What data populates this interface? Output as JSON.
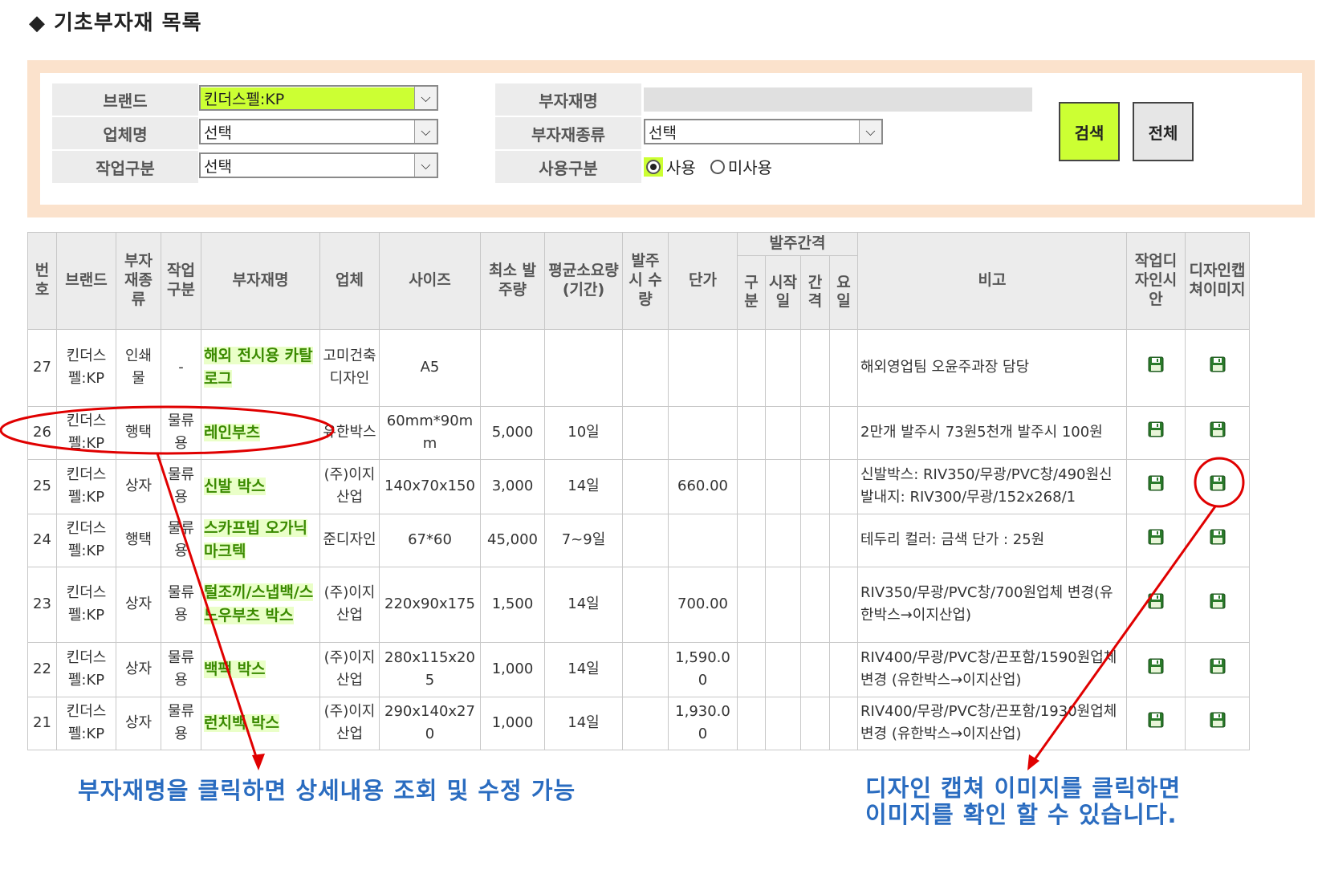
{
  "page": {
    "title": "기초부자재 목록",
    "title_icon": "diamond-icon"
  },
  "search": {
    "brand_label": "브랜드",
    "brand_value": "킨더스펠:KP",
    "vendor_label": "업체명",
    "vendor_value": "선택",
    "work_type_label": "작업구분",
    "work_type_value": "선택",
    "material_name_label": "부자재명",
    "material_name_value": "",
    "material_type_label": "부자재종류",
    "material_type_value": "선택",
    "usage_label": "사용구분",
    "usage_options": [
      "사용",
      "미사용"
    ],
    "usage_selected": "사용",
    "search_button": "검색",
    "all_button": "전체"
  },
  "table": {
    "headers": {
      "no": "번호",
      "brand": "브랜드",
      "material_type": "부자재종류",
      "work_type": "작업구분",
      "material_name": "부자재명",
      "vendor": "업체",
      "size": "사이즈",
      "min_order": "최소 발주량",
      "avg_lead": "평균소요량(기간)",
      "order_start_qty": "발주시 수량",
      "unit_price": "단가",
      "order_interval": "발주간격",
      "interval_type": "구분",
      "interval_start": "시작일",
      "interval_gap": "간격",
      "interval_day": "요일",
      "note": "비고",
      "work_design": "작업디자인시안",
      "design_capture": "디자인캡쳐이미지"
    },
    "rows": [
      {
        "no": "27",
        "brand": "킨더스펠:KP",
        "type": "인쇄물",
        "work": "-",
        "name": "해외 전시용 카탈로그",
        "vendor": "고미건축디자인",
        "size": "A5",
        "min": "",
        "avg": "",
        "qty": "",
        "price": "",
        "note": "해외영업팀 오윤주과장 담당"
      },
      {
        "no": "26",
        "brand": "킨더스펠:KP",
        "type": "행택",
        "work": "물류용",
        "name": "레인부츠",
        "vendor": "유한박스",
        "size": "60mm*90mm",
        "min": "5,000",
        "avg": "10일",
        "qty": "",
        "price": "",
        "note": "2만개 발주시 73원5천개 발주시 100원"
      },
      {
        "no": "25",
        "brand": "킨더스펠:KP",
        "type": "상자",
        "work": "물류용",
        "name": "신발 박스",
        "vendor": "(주)이지산업",
        "size": "140x70x150",
        "min": "3,000",
        "avg": "14일",
        "qty": "",
        "price": "660.00",
        "note": "신발박스: RIV350/무광/PVC창/490원신발내지: RIV300/무광/152x268/1"
      },
      {
        "no": "24",
        "brand": "킨더스펠:KP",
        "type": "행택",
        "work": "물류용",
        "name": "스카프빕 오가닉마크텍",
        "vendor": "준디자인",
        "size": "67*60",
        "min": "45,000",
        "avg": "7~9일",
        "qty": "",
        "price": "",
        "note": "테두리 컬러: 금색 단가 : 25원"
      },
      {
        "no": "23",
        "brand": "킨더스펠:KP",
        "type": "상자",
        "work": "물류용",
        "name": "털조끼/스냅백/스노우부츠 박스",
        "vendor": "(주)이지산업",
        "size": "220x90x175",
        "min": "1,500",
        "avg": "14일",
        "qty": "",
        "price": "700.00",
        "note": "RIV350/무광/PVC창/700원업체 변경(유한박스→이지산업)"
      },
      {
        "no": "22",
        "brand": "킨더스펠:KP",
        "type": "상자",
        "work": "물류용",
        "name": "백팩 박스",
        "vendor": "(주)이지산업",
        "size": "280x115x205",
        "min": "1,000",
        "avg": "14일",
        "qty": "",
        "price": "1,590.00",
        "note": "RIV400/무광/PVC창/끈포함/1590원업체 변경 (유한박스→이지산업)"
      },
      {
        "no": "21",
        "brand": "킨더스펠:KP",
        "type": "상자",
        "work": "물류용",
        "name": "런치백 박스",
        "vendor": "(주)이지산업",
        "size": "290x140x270",
        "min": "1,000",
        "avg": "14일",
        "qty": "",
        "price": "1,930.00",
        "note": "RIV400/무광/PVC창/끈포함/1930원업체 변경 (유한박스→이지산업)"
      }
    ]
  },
  "annotations": {
    "left": "부자재명을 클릭하면 상세내용 조회 및 수정 가능",
    "right_line1": "디자인 캡쳐 이미지를 클릭하면",
    "right_line2": "이미지를 확인 할 수 있습니다."
  },
  "colors": {
    "accent_green": "#ccff33",
    "panel_border": "#fbe2cc",
    "annotation_blue": "#2a6cc0",
    "callout_red": "#e00000"
  }
}
